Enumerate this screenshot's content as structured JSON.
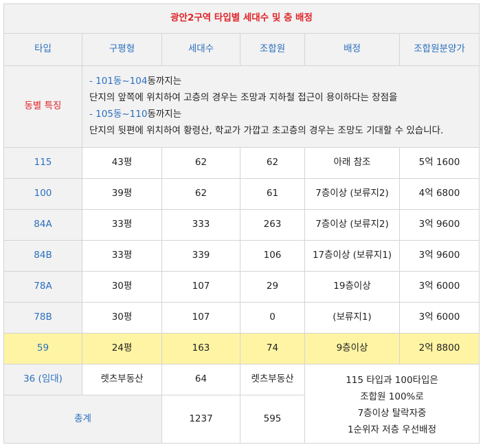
{
  "title": "광안2구역 타입별 세대수 및 층 배정",
  "headers": [
    "타입",
    "구평형",
    "세대수",
    "조합원",
    "배정",
    "조합원분양가"
  ],
  "features": {
    "label": "동별 특징",
    "line1_blue": "- 101동~104",
    "line1_rest": "동까지는",
    "line2": "단지의 앞쪽에 위치하여 고층의 경우는 조망과 지하철 접근이 용이하다는 장점을",
    "line3_blue": "- 105동~110",
    "line3_rest": "동까지는",
    "line4": "단지의 뒷편에 위치하여 황령산, 학교가 가깝고 초고층의 경우는 조망도 기대할 수 있습니다."
  },
  "rows": [
    {
      "type": "115",
      "pyeong": "43평",
      "units": "62",
      "members": "62",
      "assign": "아래 참조",
      "price": "5억 1600"
    },
    {
      "type": "100",
      "pyeong": "39평",
      "units": "62",
      "members": "61",
      "assign": "7층이상 (보류지2)",
      "price": "4억 6800"
    },
    {
      "type": "84A",
      "pyeong": "33평",
      "units": "333",
      "members": "263",
      "assign": "7층이상 (보류지2)",
      "price": "3억 9600"
    },
    {
      "type": "84B",
      "pyeong": "33평",
      "units": "339",
      "members": "106",
      "assign": "17층이상 (보류지1)",
      "price": "3억 9600"
    },
    {
      "type": "78A",
      "pyeong": "30평",
      "units": "107",
      "members": "29",
      "assign": "19층이상",
      "price": "3억 6000"
    },
    {
      "type": "78B",
      "pyeong": "30평",
      "units": "107",
      "members": "0",
      "assign": "(보류지1)",
      "price": "3억 6000"
    },
    {
      "type": "59",
      "pyeong": "24평",
      "units": "163",
      "members": "74",
      "assign": "9층이상",
      "price": "2억 8800"
    }
  ],
  "rental": {
    "type": "36 (임대)",
    "pyeong": "렛츠부동산",
    "units": "64",
    "members": "렛츠부동산"
  },
  "total": {
    "label": "총계",
    "units": "1237",
    "members": "595"
  },
  "note": [
    "115 타입과 100타입은",
    "조합원 100%로",
    "7층이상 탈락자중",
    "1순위자 저층 우선배정"
  ]
}
